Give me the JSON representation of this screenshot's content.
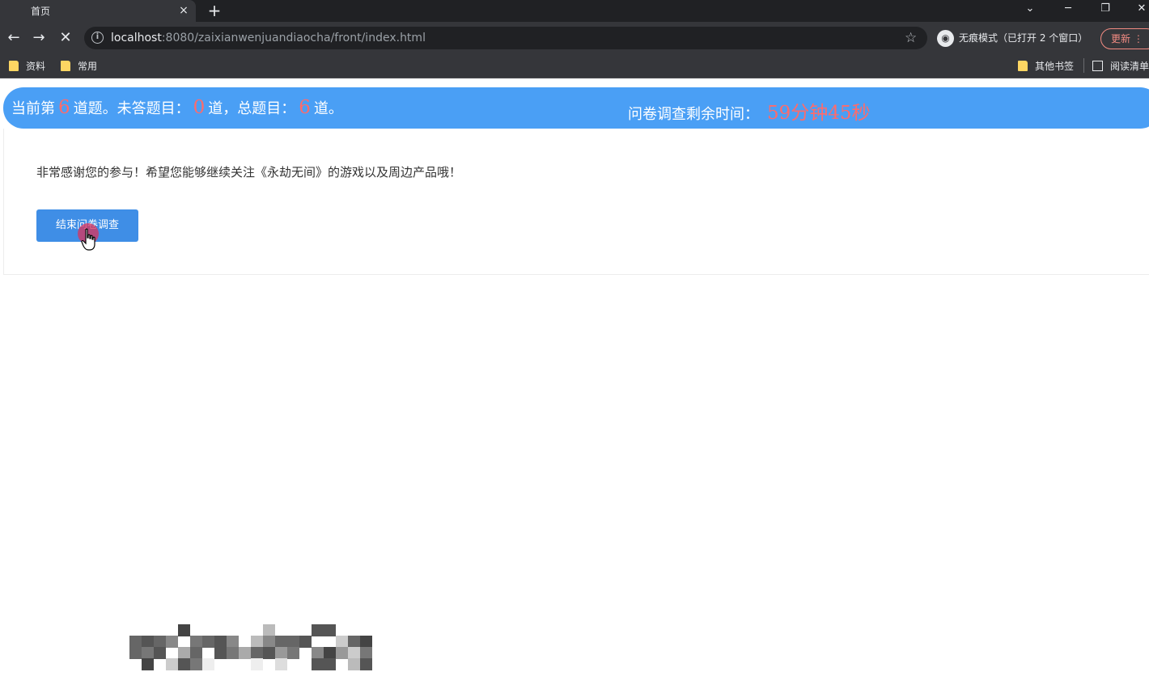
{
  "browser": {
    "tab_title": "首页",
    "tab_close": "×",
    "new_tab": "+",
    "url_host": "localhost",
    "url_rest": ":8080/zaixianwenjuandiaocha/front/index.html",
    "incognito_label": "无痕模式（已打开 2 个窗口）",
    "update_label": "更新",
    "bookmarks": [
      {
        "label": "资料"
      },
      {
        "label": "常用"
      },
      {
        "label": "其他书签"
      },
      {
        "label": "阅读清单"
      }
    ]
  },
  "survey": {
    "progress_prefix": "当前第",
    "current_question": "6",
    "progress_mid1": "道题。未答题目：",
    "unanswered": "0",
    "progress_mid2": "道，总题目：",
    "total": "6",
    "progress_suffix": "道。",
    "timer_label": "问卷调查剩余时间：",
    "timer_value": "59分钟45秒",
    "thanks_message": "非常感谢您的参与！希望您能够继续关注《永劫无间》的游戏以及周边产品哦！",
    "end_button_label": "结束问卷调查"
  },
  "colors": {
    "status_bar": "#4a9ff5",
    "highlight_number": "#ff6b6b",
    "button": "#3f8ee6"
  }
}
